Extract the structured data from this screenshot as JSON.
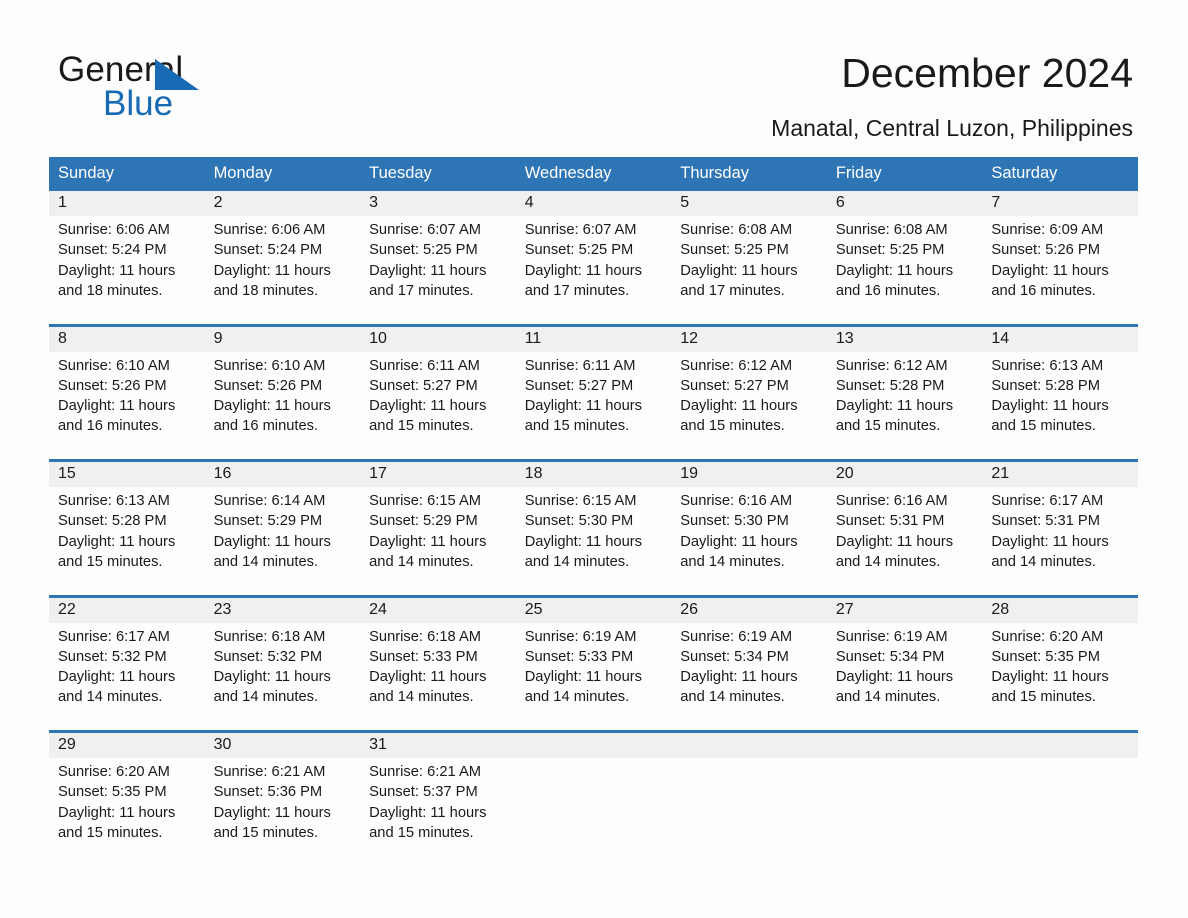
{
  "brand": {
    "name_part1": "General",
    "name_part2": "Blue",
    "accent_color": "#176ab4",
    "header_color": "#2e75b6"
  },
  "header": {
    "title": "December 2024",
    "subtitle": "Manatal, Central Luzon, Philippines"
  },
  "calendar": {
    "weekday_headers": [
      "Sunday",
      "Monday",
      "Tuesday",
      "Wednesday",
      "Thursday",
      "Friday",
      "Saturday"
    ],
    "weeks": [
      [
        {
          "day": "1",
          "sunrise": "Sunrise: 6:06 AM",
          "sunset": "Sunset: 5:24 PM",
          "daylight_line1": "Daylight: 11 hours",
          "daylight_line2": "and 18 minutes."
        },
        {
          "day": "2",
          "sunrise": "Sunrise: 6:06 AM",
          "sunset": "Sunset: 5:24 PM",
          "daylight_line1": "Daylight: 11 hours",
          "daylight_line2": "and 18 minutes."
        },
        {
          "day": "3",
          "sunrise": "Sunrise: 6:07 AM",
          "sunset": "Sunset: 5:25 PM",
          "daylight_line1": "Daylight: 11 hours",
          "daylight_line2": "and 17 minutes."
        },
        {
          "day": "4",
          "sunrise": "Sunrise: 6:07 AM",
          "sunset": "Sunset: 5:25 PM",
          "daylight_line1": "Daylight: 11 hours",
          "daylight_line2": "and 17 minutes."
        },
        {
          "day": "5",
          "sunrise": "Sunrise: 6:08 AM",
          "sunset": "Sunset: 5:25 PM",
          "daylight_line1": "Daylight: 11 hours",
          "daylight_line2": "and 17 minutes."
        },
        {
          "day": "6",
          "sunrise": "Sunrise: 6:08 AM",
          "sunset": "Sunset: 5:25 PM",
          "daylight_line1": "Daylight: 11 hours",
          "daylight_line2": "and 16 minutes."
        },
        {
          "day": "7",
          "sunrise": "Sunrise: 6:09 AM",
          "sunset": "Sunset: 5:26 PM",
          "daylight_line1": "Daylight: 11 hours",
          "daylight_line2": "and 16 minutes."
        }
      ],
      [
        {
          "day": "8",
          "sunrise": "Sunrise: 6:10 AM",
          "sunset": "Sunset: 5:26 PM",
          "daylight_line1": "Daylight: 11 hours",
          "daylight_line2": "and 16 minutes."
        },
        {
          "day": "9",
          "sunrise": "Sunrise: 6:10 AM",
          "sunset": "Sunset: 5:26 PM",
          "daylight_line1": "Daylight: 11 hours",
          "daylight_line2": "and 16 minutes."
        },
        {
          "day": "10",
          "sunrise": "Sunrise: 6:11 AM",
          "sunset": "Sunset: 5:27 PM",
          "daylight_line1": "Daylight: 11 hours",
          "daylight_line2": "and 15 minutes."
        },
        {
          "day": "11",
          "sunrise": "Sunrise: 6:11 AM",
          "sunset": "Sunset: 5:27 PM",
          "daylight_line1": "Daylight: 11 hours",
          "daylight_line2": "and 15 minutes."
        },
        {
          "day": "12",
          "sunrise": "Sunrise: 6:12 AM",
          "sunset": "Sunset: 5:27 PM",
          "daylight_line1": "Daylight: 11 hours",
          "daylight_line2": "and 15 minutes."
        },
        {
          "day": "13",
          "sunrise": "Sunrise: 6:12 AM",
          "sunset": "Sunset: 5:28 PM",
          "daylight_line1": "Daylight: 11 hours",
          "daylight_line2": "and 15 minutes."
        },
        {
          "day": "14",
          "sunrise": "Sunrise: 6:13 AM",
          "sunset": "Sunset: 5:28 PM",
          "daylight_line1": "Daylight: 11 hours",
          "daylight_line2": "and 15 minutes."
        }
      ],
      [
        {
          "day": "15",
          "sunrise": "Sunrise: 6:13 AM",
          "sunset": "Sunset: 5:28 PM",
          "daylight_line1": "Daylight: 11 hours",
          "daylight_line2": "and 15 minutes."
        },
        {
          "day": "16",
          "sunrise": "Sunrise: 6:14 AM",
          "sunset": "Sunset: 5:29 PM",
          "daylight_line1": "Daylight: 11 hours",
          "daylight_line2": "and 14 minutes."
        },
        {
          "day": "17",
          "sunrise": "Sunrise: 6:15 AM",
          "sunset": "Sunset: 5:29 PM",
          "daylight_line1": "Daylight: 11 hours",
          "daylight_line2": "and 14 minutes."
        },
        {
          "day": "18",
          "sunrise": "Sunrise: 6:15 AM",
          "sunset": "Sunset: 5:30 PM",
          "daylight_line1": "Daylight: 11 hours",
          "daylight_line2": "and 14 minutes."
        },
        {
          "day": "19",
          "sunrise": "Sunrise: 6:16 AM",
          "sunset": "Sunset: 5:30 PM",
          "daylight_line1": "Daylight: 11 hours",
          "daylight_line2": "and 14 minutes."
        },
        {
          "day": "20",
          "sunrise": "Sunrise: 6:16 AM",
          "sunset": "Sunset: 5:31 PM",
          "daylight_line1": "Daylight: 11 hours",
          "daylight_line2": "and 14 minutes."
        },
        {
          "day": "21",
          "sunrise": "Sunrise: 6:17 AM",
          "sunset": "Sunset: 5:31 PM",
          "daylight_line1": "Daylight: 11 hours",
          "daylight_line2": "and 14 minutes."
        }
      ],
      [
        {
          "day": "22",
          "sunrise": "Sunrise: 6:17 AM",
          "sunset": "Sunset: 5:32 PM",
          "daylight_line1": "Daylight: 11 hours",
          "daylight_line2": "and 14 minutes."
        },
        {
          "day": "23",
          "sunrise": "Sunrise: 6:18 AM",
          "sunset": "Sunset: 5:32 PM",
          "daylight_line1": "Daylight: 11 hours",
          "daylight_line2": "and 14 minutes."
        },
        {
          "day": "24",
          "sunrise": "Sunrise: 6:18 AM",
          "sunset": "Sunset: 5:33 PM",
          "daylight_line1": "Daylight: 11 hours",
          "daylight_line2": "and 14 minutes."
        },
        {
          "day": "25",
          "sunrise": "Sunrise: 6:19 AM",
          "sunset": "Sunset: 5:33 PM",
          "daylight_line1": "Daylight: 11 hours",
          "daylight_line2": "and 14 minutes."
        },
        {
          "day": "26",
          "sunrise": "Sunrise: 6:19 AM",
          "sunset": "Sunset: 5:34 PM",
          "daylight_line1": "Daylight: 11 hours",
          "daylight_line2": "and 14 minutes."
        },
        {
          "day": "27",
          "sunrise": "Sunrise: 6:19 AM",
          "sunset": "Sunset: 5:34 PM",
          "daylight_line1": "Daylight: 11 hours",
          "daylight_line2": "and 14 minutes."
        },
        {
          "day": "28",
          "sunrise": "Sunrise: 6:20 AM",
          "sunset": "Sunset: 5:35 PM",
          "daylight_line1": "Daylight: 11 hours",
          "daylight_line2": "and 15 minutes."
        }
      ],
      [
        {
          "day": "29",
          "sunrise": "Sunrise: 6:20 AM",
          "sunset": "Sunset: 5:35 PM",
          "daylight_line1": "Daylight: 11 hours",
          "daylight_line2": "and 15 minutes."
        },
        {
          "day": "30",
          "sunrise": "Sunrise: 6:21 AM",
          "sunset": "Sunset: 5:36 PM",
          "daylight_line1": "Daylight: 11 hours",
          "daylight_line2": "and 15 minutes."
        },
        {
          "day": "31",
          "sunrise": "Sunrise: 6:21 AM",
          "sunset": "Sunset: 5:37 PM",
          "daylight_line1": "Daylight: 11 hours",
          "daylight_line2": "and 15 minutes."
        },
        {
          "day": "",
          "sunrise": "",
          "sunset": "",
          "daylight_line1": "",
          "daylight_line2": ""
        },
        {
          "day": "",
          "sunrise": "",
          "sunset": "",
          "daylight_line1": "",
          "daylight_line2": ""
        },
        {
          "day": "",
          "sunrise": "",
          "sunset": "",
          "daylight_line1": "",
          "daylight_line2": ""
        },
        {
          "day": "",
          "sunrise": "",
          "sunset": "",
          "daylight_line1": "",
          "daylight_line2": ""
        }
      ]
    ]
  }
}
